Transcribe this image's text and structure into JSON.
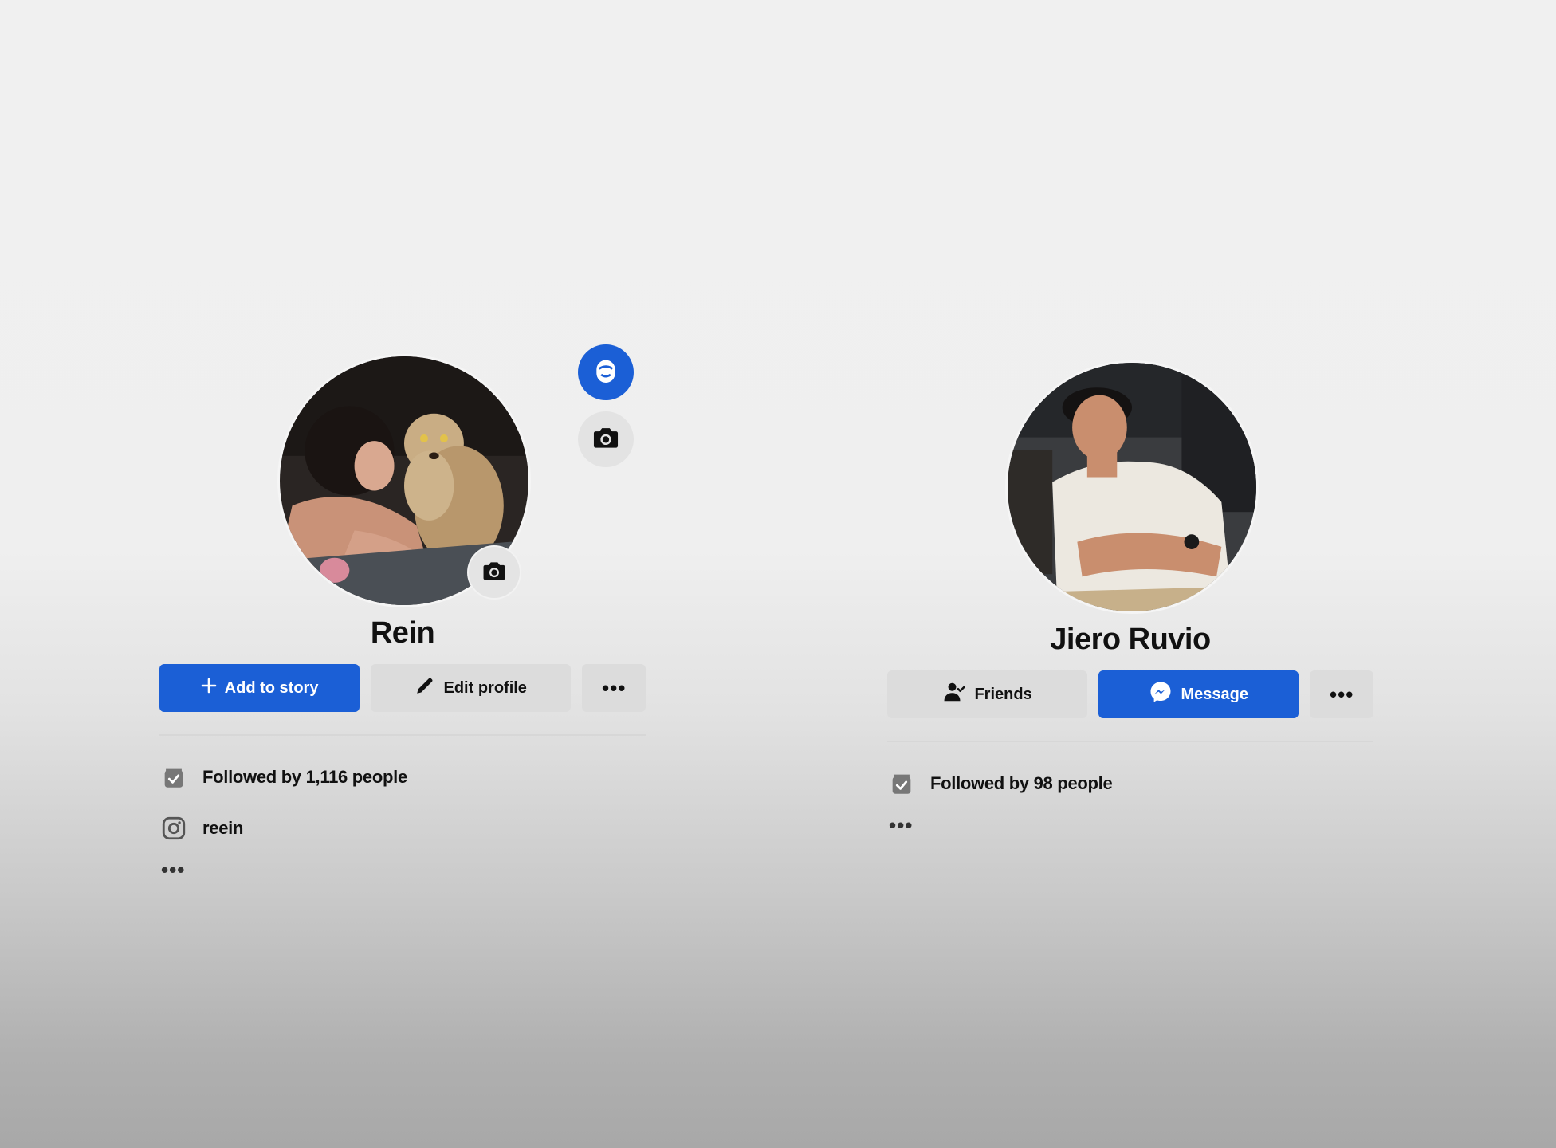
{
  "profiles": [
    {
      "name": "Rein",
      "avatar_desc_icon": "profile-photo-woman-with-dog",
      "buttons": {
        "primary_label": "Add to story",
        "secondary_label": "Edit profile",
        "more_label": "•••"
      },
      "info": {
        "followers": "Followed by 1,116 people",
        "instagram": "reein",
        "more_label": "•••"
      }
    },
    {
      "name": "Jiero Ruvio",
      "avatar_desc_icon": "profile-photo-man-white-tshirt",
      "buttons": {
        "secondary_label": "Friends",
        "primary_label": "Message",
        "more_label": "•••"
      },
      "info": {
        "followers": "Followed by 98 people",
        "more_label": "•••"
      }
    }
  ],
  "colors": {
    "primary": "#1b5fd6",
    "secondary_button": "#dcdcdc",
    "text": "#111111"
  }
}
